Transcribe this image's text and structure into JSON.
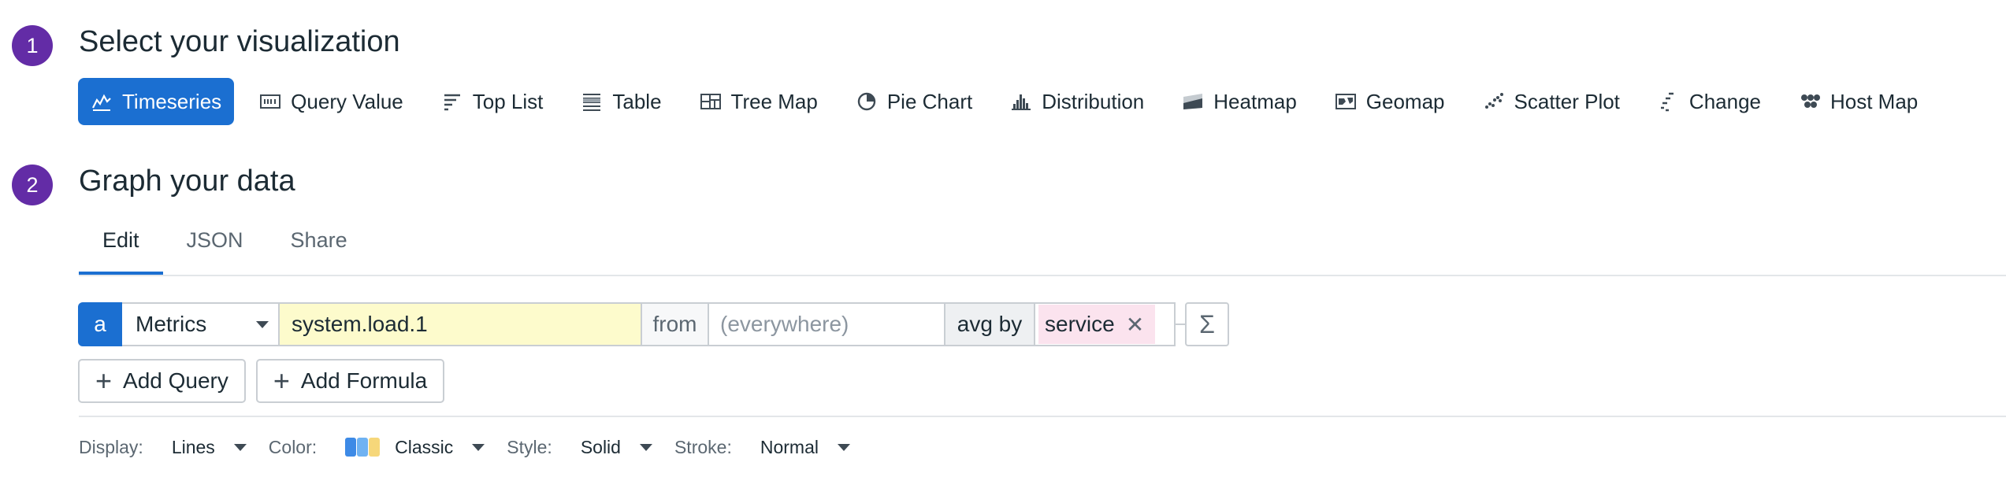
{
  "step1": {
    "number": "1",
    "title": "Select your visualization"
  },
  "visualizations": [
    {
      "label": "Timeseries",
      "icon": "timeseries-icon",
      "active": true
    },
    {
      "label": "Query Value",
      "icon": "query-value-icon"
    },
    {
      "label": "Top List",
      "icon": "top-list-icon"
    },
    {
      "label": "Table",
      "icon": "table-icon"
    },
    {
      "label": "Tree Map",
      "icon": "tree-map-icon"
    },
    {
      "label": "Pie Chart",
      "icon": "pie-chart-icon"
    },
    {
      "label": "Distribution",
      "icon": "distribution-icon"
    },
    {
      "label": "Heatmap",
      "icon": "heatmap-icon"
    },
    {
      "label": "Geomap",
      "icon": "geomap-icon"
    },
    {
      "label": "Scatter Plot",
      "icon": "scatter-plot-icon"
    },
    {
      "label": "Change",
      "icon": "change-icon"
    },
    {
      "label": "Host Map",
      "icon": "host-map-icon"
    }
  ],
  "step2": {
    "number": "2",
    "title": "Graph your data"
  },
  "tabs": [
    {
      "label": "Edit",
      "active": true
    },
    {
      "label": "JSON"
    },
    {
      "label": "Share"
    }
  ],
  "query": {
    "letter": "a",
    "source": "Metrics",
    "metric": "system.load.1",
    "from_label": "from",
    "scope_placeholder": "(everywhere)",
    "aggregation": "avg by",
    "group_tag": "service",
    "sigma": "Σ"
  },
  "buttons": {
    "add_query": "Add Query",
    "add_formula": "Add Formula"
  },
  "options": {
    "display_label": "Display:",
    "display_value": "Lines",
    "color_label": "Color:",
    "color_value": "Classic",
    "style_label": "Style:",
    "style_value": "Solid",
    "stroke_label": "Stroke:",
    "stroke_value": "Normal"
  },
  "colors": {
    "accent": "#1b6fd1",
    "step_circle": "#632ca6",
    "metric_highlight": "#fdfbcc",
    "tag_bg": "#fbe3ee",
    "palette": [
      "#3d8ae6",
      "#6fb2f2",
      "#f6d77a"
    ]
  }
}
